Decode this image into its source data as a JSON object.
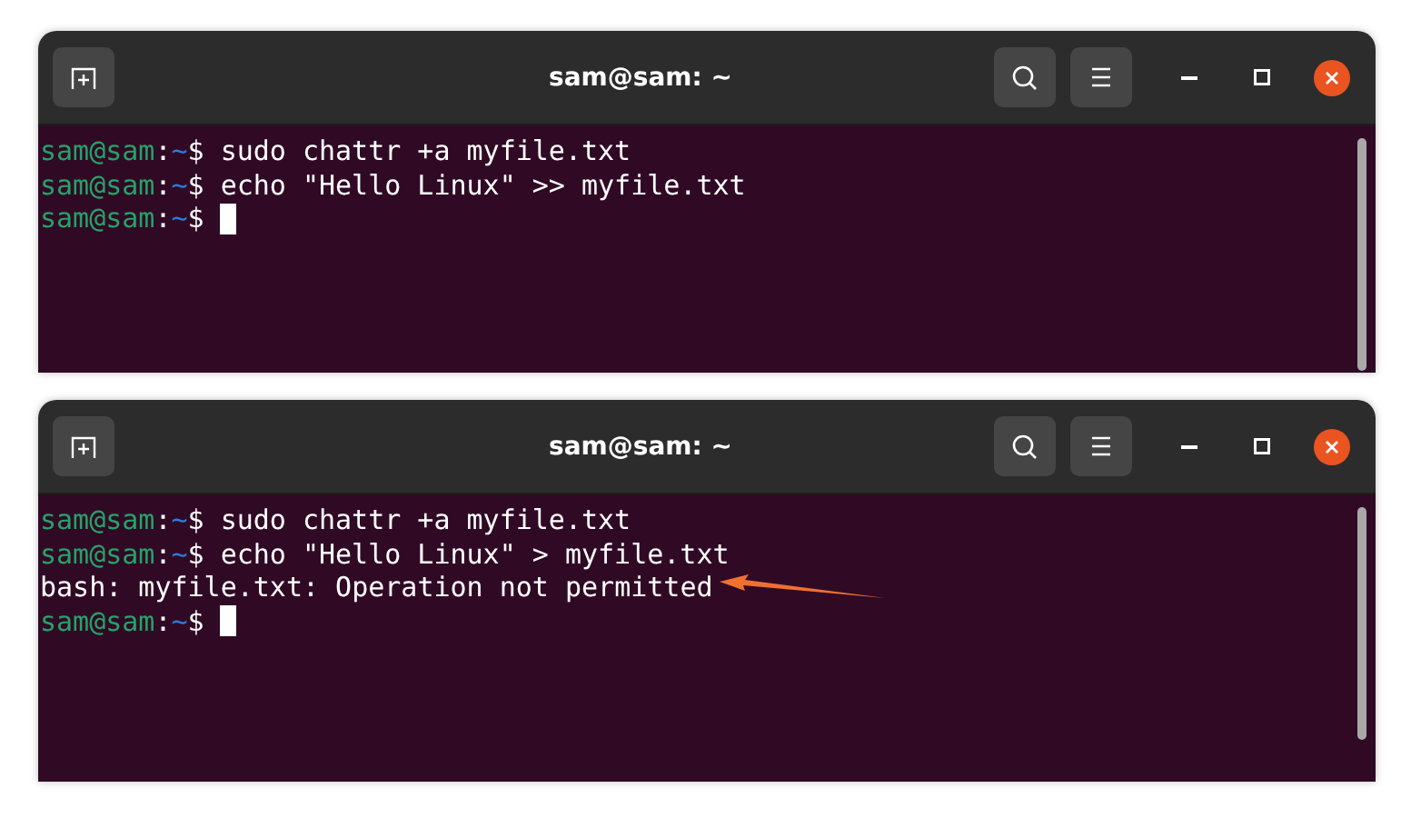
{
  "windows": [
    {
      "title": "sam@sam: ~",
      "lines": [
        {
          "kind": "prompt",
          "user": "sam@sam",
          "sep": ":",
          "path": "~",
          "symbol": "$",
          "command": "sudo chattr +a myfile.txt",
          "cursor": false
        },
        {
          "kind": "prompt",
          "user": "sam@sam",
          "sep": ":",
          "path": "~",
          "symbol": "$",
          "command": "echo \"Hello Linux\" >> myfile.txt",
          "cursor": false
        },
        {
          "kind": "prompt",
          "user": "sam@sam",
          "sep": ":",
          "path": "~",
          "symbol": "$",
          "cursor": true
        }
      ]
    },
    {
      "title": "sam@sam: ~",
      "lines": [
        {
          "kind": "prompt",
          "user": "sam@sam",
          "sep": ":",
          "path": "~",
          "symbol": "$",
          "command": "sudo chattr +a myfile.txt",
          "cursor": false
        },
        {
          "kind": "prompt",
          "user": "sam@sam",
          "sep": ":",
          "path": "~",
          "symbol": "$",
          "command": "echo \"Hello Linux\" > myfile.txt",
          "cursor": false
        },
        {
          "kind": "output",
          "text": "bash: myfile.txt: Operation not permitted",
          "arrow": true
        },
        {
          "kind": "prompt",
          "user": "sam@sam",
          "sep": ":",
          "path": "~",
          "symbol": "$",
          "cursor": true
        }
      ]
    }
  ]
}
